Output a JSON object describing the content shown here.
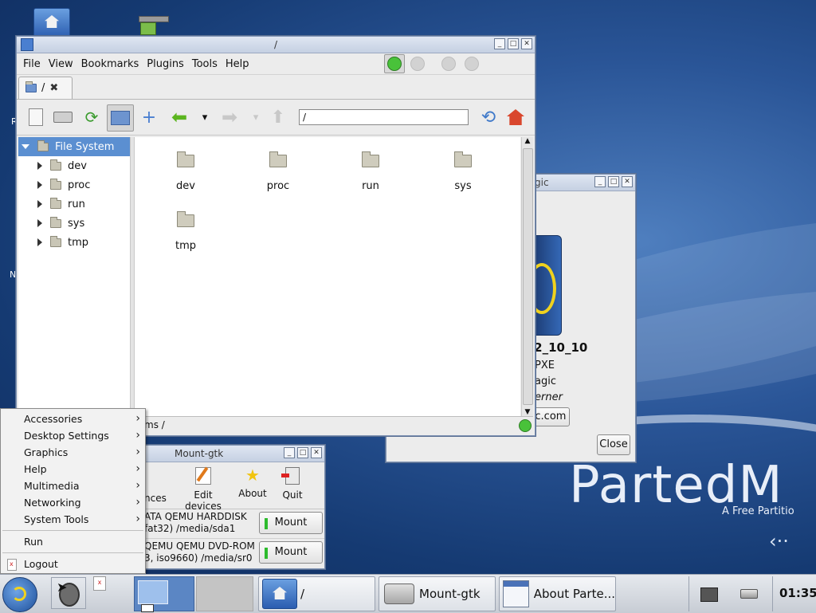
{
  "file_manager": {
    "title": "/",
    "menus": [
      "File",
      "View",
      "Bookmarks",
      "Plugins",
      "Tools",
      "Help"
    ],
    "tab_label": "/",
    "path_value": "/",
    "tree": [
      {
        "label": "File System"
      },
      {
        "label": "dev"
      },
      {
        "label": "proc"
      },
      {
        "label": "run"
      },
      {
        "label": "sys"
      },
      {
        "label": "tmp"
      }
    ],
    "items": [
      "dev",
      "proc",
      "run",
      "sys",
      "tmp"
    ],
    "status_text": "ms  /"
  },
  "about": {
    "title_partial": "gic",
    "version": "l2_10_10",
    "line1": "PXE",
    "line2": "agic",
    "line3": "erner",
    "link": "gic.com",
    "close_label": "Close"
  },
  "mount": {
    "title": "Mount-gtk",
    "toolbar": [
      "nces",
      "Edit devices",
      "About",
      "Quit"
    ],
    "devices": [
      {
        "name": "ATA QEMU HARDDISK",
        "detail": "fat32)  /media/sda1",
        "button": "Mount"
      },
      {
        "name": "QEMU QEMU DVD-ROM",
        "detail": "3, iso9660)  /media/sr0",
        "button": "Mount"
      }
    ]
  },
  "start_menu": {
    "items": [
      "Accessories",
      "Desktop Settings",
      "Graphics",
      "Help",
      "Multimedia",
      "Networking",
      "System Tools"
    ],
    "run": "Run",
    "logout": "Logout"
  },
  "desktop": {
    "brand": "PartedM",
    "brand_sub": "A Free Partitio",
    "edge_r": "R",
    "edge_n": "N"
  },
  "taskbar": {
    "tasks": [
      "/",
      "Mount-gtk",
      "About Parte..."
    ],
    "clock": "01:35"
  }
}
